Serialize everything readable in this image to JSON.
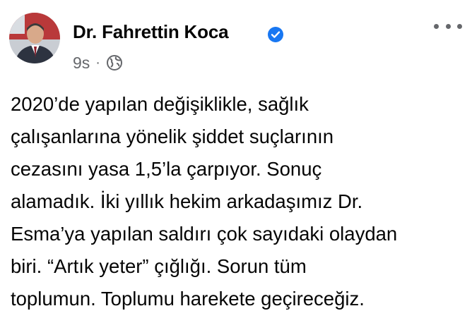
{
  "author": {
    "name": "Dr. Fahrettin Koca",
    "verified_icon": "verified-badge-icon",
    "avatar_icon": "profile-photo"
  },
  "meta": {
    "time": "9s",
    "separator": "·",
    "audience_icon": "globe-icon"
  },
  "more_icon": "more-options-icon",
  "post": {
    "lines": [
      "2020’de yapılan değişiklikle, sağlık",
      "çalışanlarına yönelik şiddet suçlarının",
      "cezasını yasa 1,5’la çarpıyor. Sonuç",
      "alamadık. İki yıllık hekim arkadaşımız Dr.",
      "Esma’ya yapılan saldırı çok sayıdaki olaydan",
      "biri. “Artık yeter” çığlığı. Sorun tüm",
      "toplumun. Toplumu harekete geçireceğiz."
    ]
  },
  "colors": {
    "verified": "#1877f2",
    "meta_text": "#65676b",
    "body_text": "#050505",
    "background": "#ffffff"
  }
}
